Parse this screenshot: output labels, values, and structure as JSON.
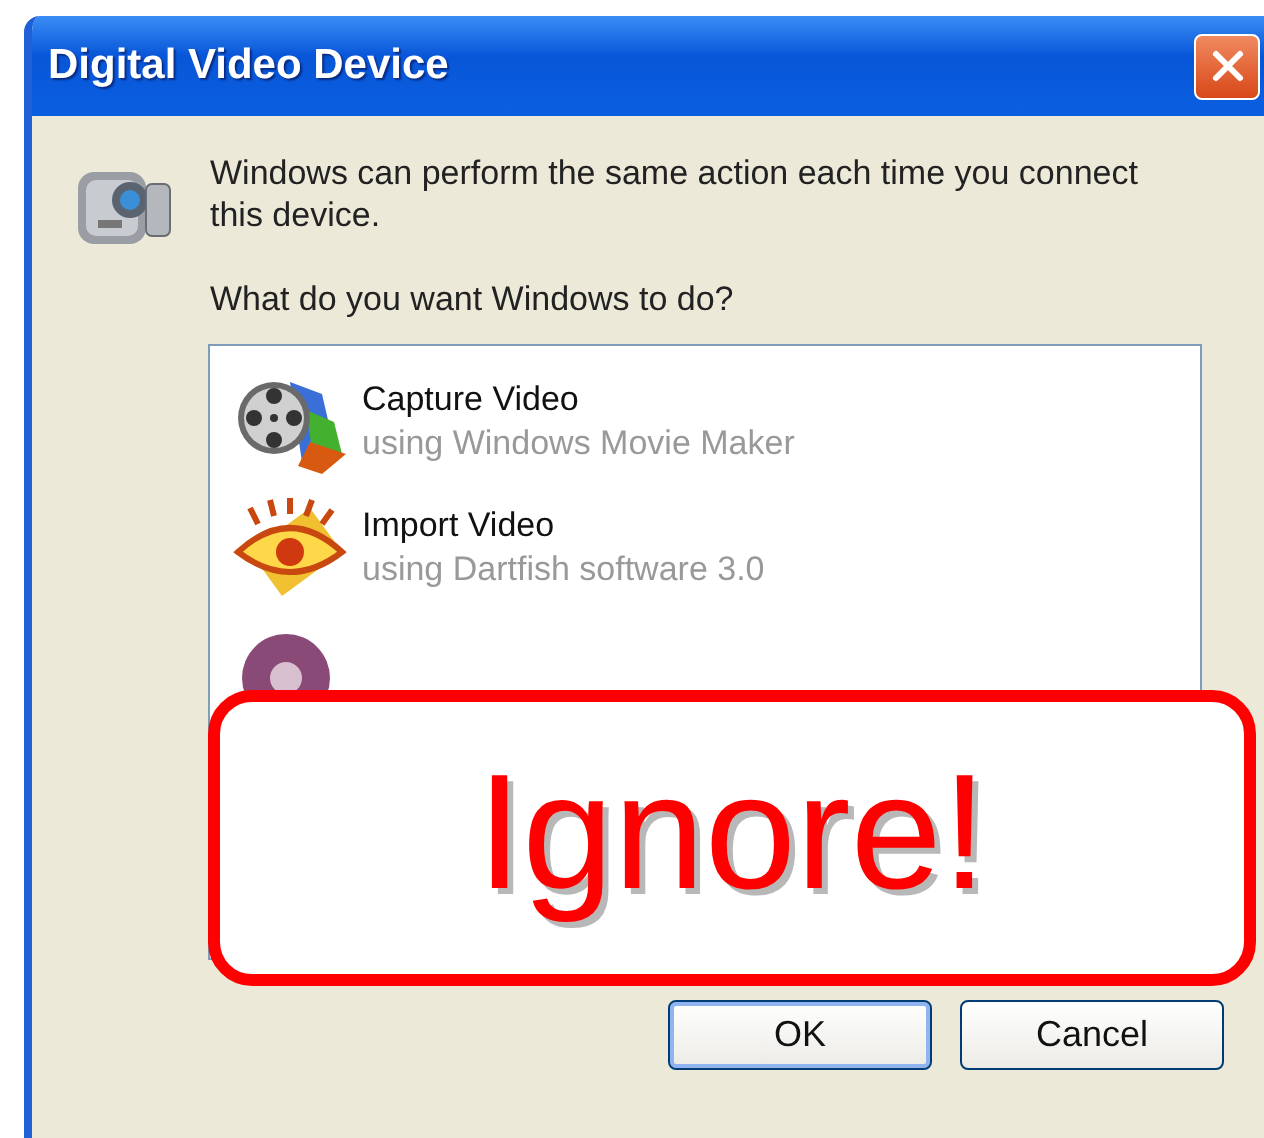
{
  "window": {
    "title": "Digital Video Device"
  },
  "message": "Windows can perform the same action each time you connect this device.",
  "question": "What do you want Windows to do?",
  "actions": [
    {
      "kind": "film-reel",
      "title": "Capture Video",
      "subtitle": "using Windows Movie Maker"
    },
    {
      "kind": "eye",
      "title": "Import Video",
      "subtitle": "using Dartfish software 3.0"
    },
    {
      "kind": "disc"
    }
  ],
  "buttons": [
    "OK",
    "Cancel"
  ],
  "callout": {
    "text": "Ignore!"
  }
}
